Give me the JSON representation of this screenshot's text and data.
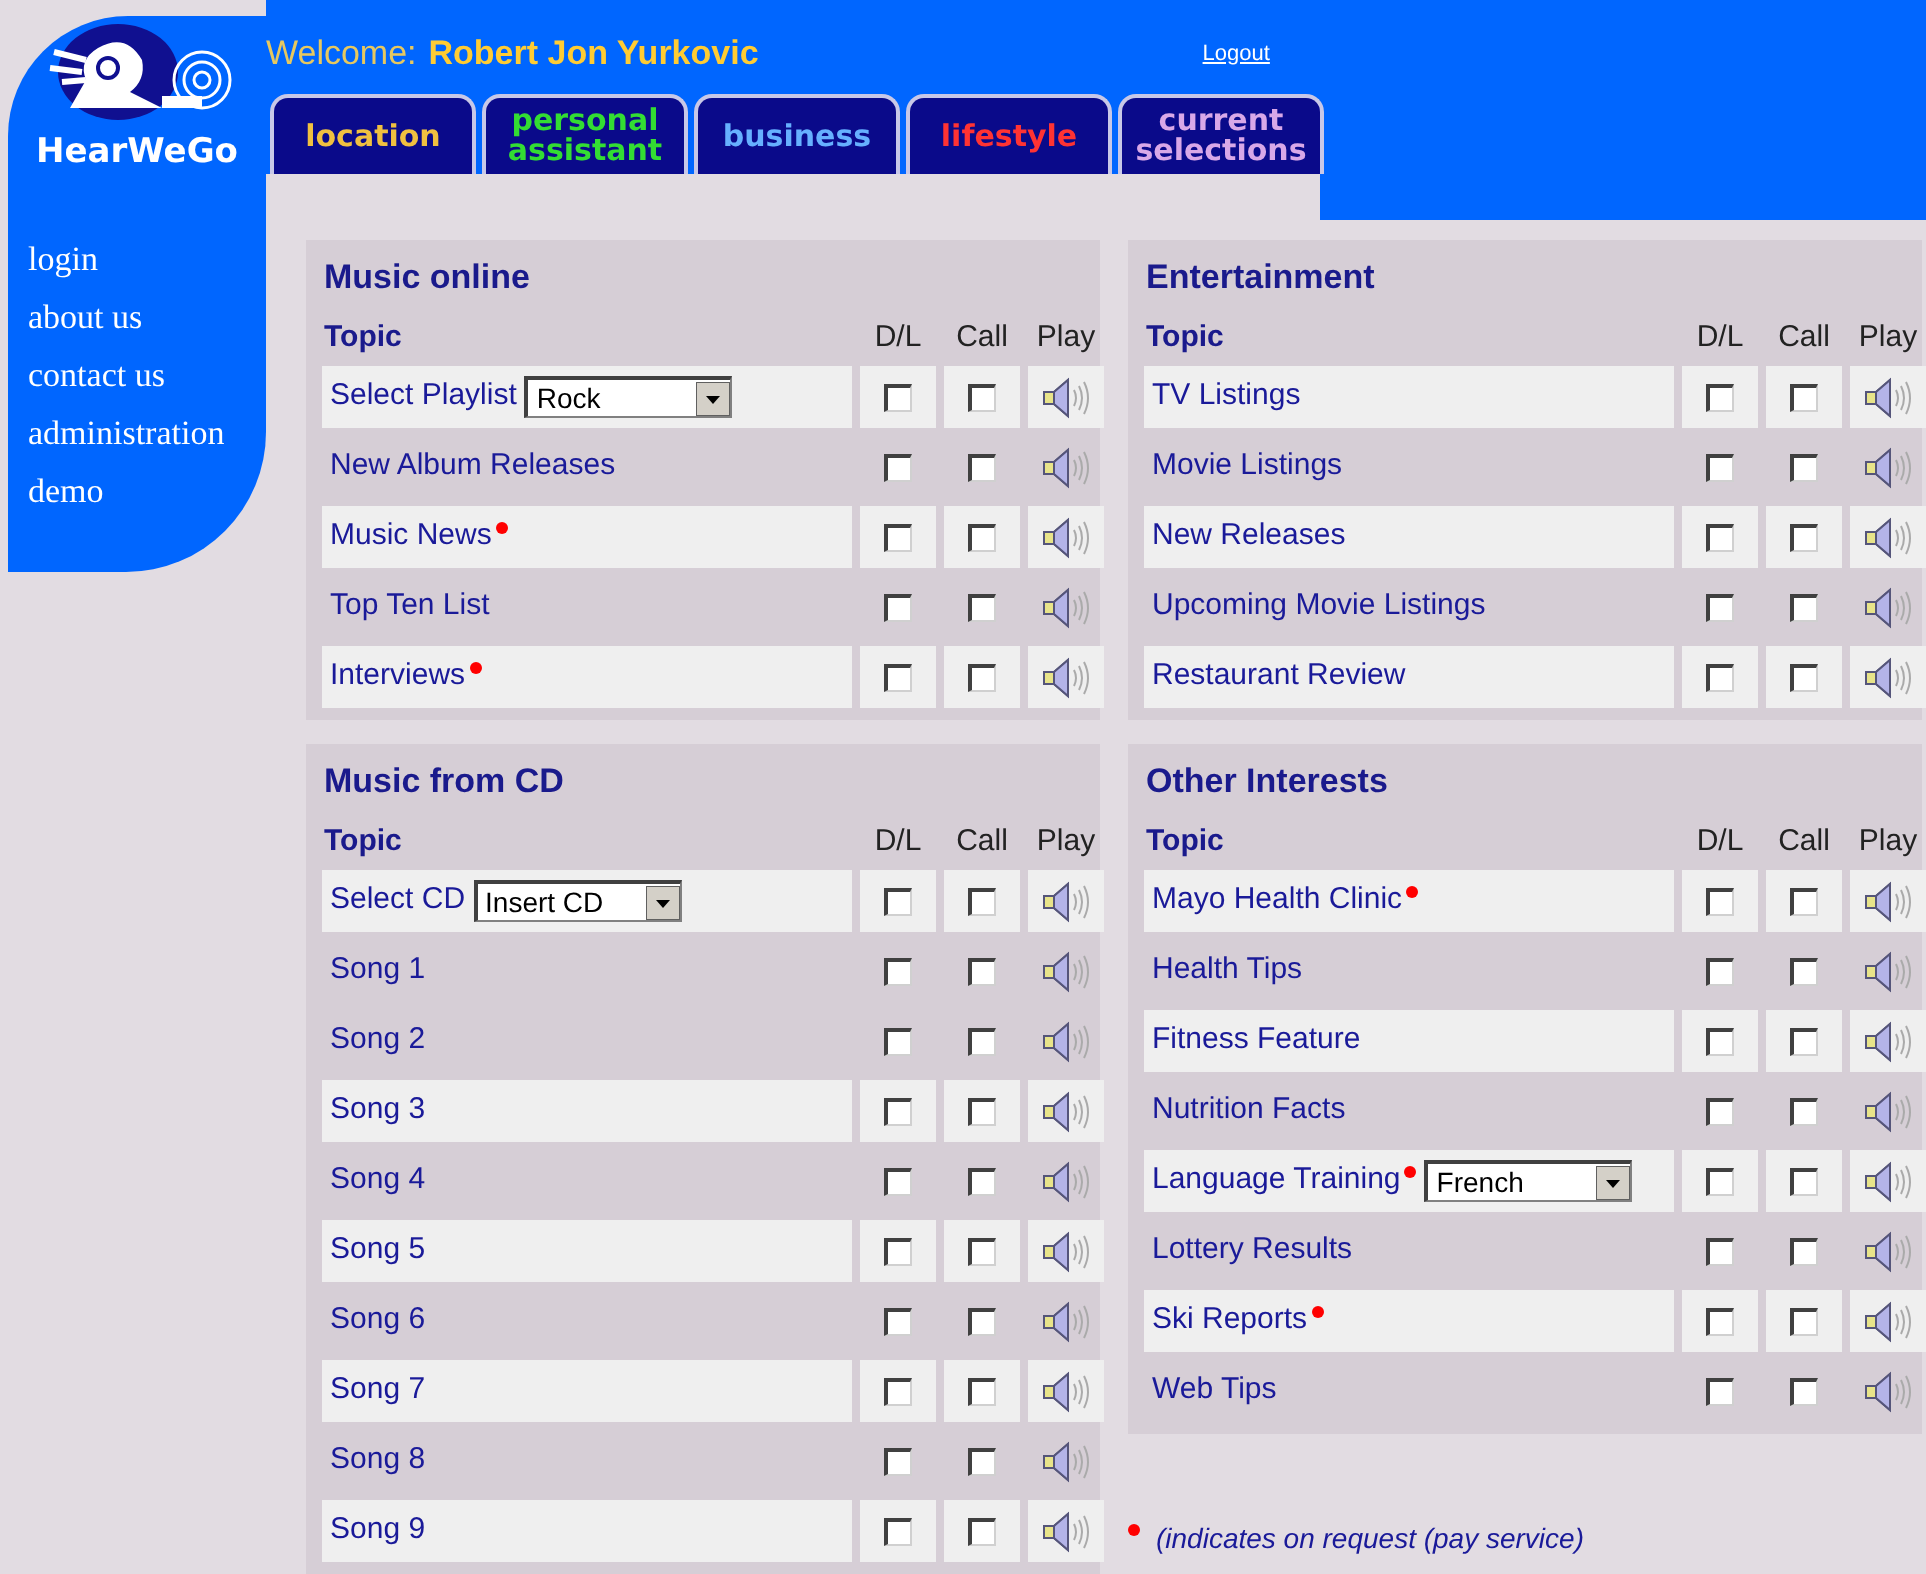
{
  "logo": {
    "text": "HearWeGo"
  },
  "welcome": {
    "label": "Welcome:",
    "name": "Robert Jon Yurkovic"
  },
  "logout": "Logout",
  "tabs": [
    {
      "label": "location",
      "color": "#f0c040"
    },
    {
      "label": "personal assistant",
      "color": "#33dd33"
    },
    {
      "label": "business",
      "color": "#66b0ff"
    },
    {
      "label": "lifestyle",
      "color": "#ff3333"
    },
    {
      "label": "current selections",
      "color": "#d8a8e8"
    }
  ],
  "sidebar": {
    "items": [
      "login",
      "about us",
      "contact us",
      "administration",
      "demo"
    ]
  },
  "columns": [
    {
      "panels": [
        {
          "title": "Music online",
          "headers": {
            "topic": "Topic",
            "dl": "D/L",
            "call": "Call",
            "play": "Play"
          },
          "rows": [
            {
              "label": "Select Playlist",
              "shaded": true,
              "paid": false,
              "select": {
                "value": "Rock"
              },
              "dl": false,
              "call": false
            },
            {
              "label": "New Album Releases",
              "shaded": false,
              "paid": false,
              "dl": false,
              "call": false
            },
            {
              "label": "Music News",
              "shaded": true,
              "paid": true,
              "dl": false,
              "call": false
            },
            {
              "label": "Top Ten List",
              "shaded": false,
              "paid": false,
              "dl": false,
              "call": false
            },
            {
              "label": "Interviews",
              "shaded": true,
              "paid": true,
              "dl": false,
              "call": false
            }
          ]
        },
        {
          "title": "Music from CD",
          "headers": {
            "topic": "Topic",
            "dl": "D/L",
            "call": "Call",
            "play": "Play"
          },
          "rows": [
            {
              "label": "Select CD",
              "shaded": true,
              "paid": false,
              "select": {
                "value": "Insert CD"
              },
              "dl": false,
              "call": false
            },
            {
              "label": "Song 1",
              "shaded": false,
              "paid": false,
              "dl": false,
              "call": false
            },
            {
              "label": "Song 2",
              "shaded": false,
              "paid": false,
              "dl": false,
              "call": false
            },
            {
              "label": "Song 3",
              "shaded": true,
              "paid": false,
              "dl": false,
              "call": false
            },
            {
              "label": "Song 4",
              "shaded": false,
              "paid": false,
              "dl": false,
              "call": false
            },
            {
              "label": "Song 5",
              "shaded": true,
              "paid": false,
              "dl": false,
              "call": false
            },
            {
              "label": "Song 6",
              "shaded": false,
              "paid": false,
              "dl": false,
              "call": false
            },
            {
              "label": "Song 7",
              "shaded": true,
              "paid": false,
              "dl": false,
              "call": false
            },
            {
              "label": "Song 8",
              "shaded": false,
              "paid": false,
              "dl": false,
              "call": false
            },
            {
              "label": "Song 9",
              "shaded": true,
              "paid": false,
              "dl": false,
              "call": false
            }
          ]
        }
      ]
    },
    {
      "panels": [
        {
          "title": "Entertainment",
          "headers": {
            "topic": "Topic",
            "dl": "D/L",
            "call": "Call",
            "play": "Play"
          },
          "rows": [
            {
              "label": "TV Listings",
              "shaded": true,
              "paid": false,
              "dl": false,
              "call": false
            },
            {
              "label": "Movie Listings",
              "shaded": false,
              "paid": false,
              "dl": false,
              "call": false
            },
            {
              "label": "New Releases",
              "shaded": true,
              "paid": false,
              "dl": false,
              "call": false
            },
            {
              "label": "Upcoming Movie Listings",
              "shaded": false,
              "paid": false,
              "dl": false,
              "call": false
            },
            {
              "label": "Restaurant Review",
              "shaded": true,
              "paid": false,
              "dl": false,
              "call": false
            }
          ]
        },
        {
          "title": "Other Interests",
          "headers": {
            "topic": "Topic",
            "dl": "D/L",
            "call": "Call",
            "play": "Play"
          },
          "rows": [
            {
              "label": "Mayo Health Clinic",
              "shaded": true,
              "paid": true,
              "dl": false,
              "call": false
            },
            {
              "label": "Health Tips",
              "shaded": false,
              "paid": false,
              "dl": false,
              "call": false
            },
            {
              "label": "Fitness Feature",
              "shaded": true,
              "paid": false,
              "dl": false,
              "call": false
            },
            {
              "label": "Nutrition Facts",
              "shaded": false,
              "paid": false,
              "dl": false,
              "call": false
            },
            {
              "label": "Language Training",
              "shaded": true,
              "paid": true,
              "select": {
                "value": "French"
              },
              "dl": false,
              "call": false
            },
            {
              "label": "Lottery Results",
              "shaded": false,
              "paid": false,
              "dl": false,
              "call": false
            },
            {
              "label": "Ski Reports",
              "shaded": true,
              "paid": true,
              "dl": false,
              "call": false
            },
            {
              "label": "Web Tips",
              "shaded": false,
              "paid": false,
              "dl": false,
              "call": false
            }
          ]
        }
      ],
      "footnote": {
        "text": "(indicates on request (pay service)"
      }
    }
  ]
}
